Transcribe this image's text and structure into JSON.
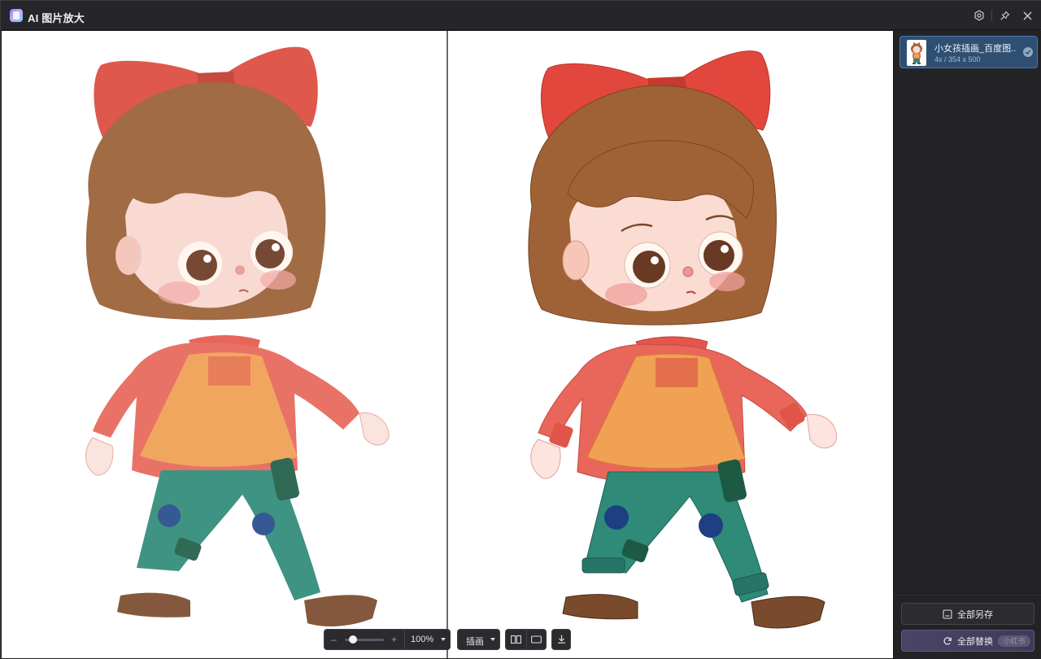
{
  "window": {
    "title": "AI 图片放大"
  },
  "titlebar_icons": [
    "settings-icon",
    "pin-icon",
    "close-icon"
  ],
  "toolbar": {
    "zoom_minus": "–",
    "zoom_plus": "+",
    "zoom_value": "100%",
    "zoom_level": 0.1,
    "mode_label": "插画",
    "view_icons": [
      "side-by-side-icon",
      "single-view-icon"
    ],
    "download_icon": "download-icon"
  },
  "sidebar": {
    "files": [
      {
        "name": "小女孩插画_百度图...",
        "meta": "4x / 354 x 500",
        "selected": true
      }
    ],
    "save_all_label": "全部另存",
    "replace_all_label": "全部替换",
    "watermark": "小红书"
  },
  "colors": {
    "accent": "#2f4f72",
    "accent_border": "#4c77a8",
    "replace_button": "#4a4466",
    "bow": "#e2473d",
    "hair": "#9a5f35",
    "sweater": "#e8675a",
    "apron": "#ef9f52",
    "pants": "#2f8a78",
    "shoes": "#7a4a2c"
  }
}
